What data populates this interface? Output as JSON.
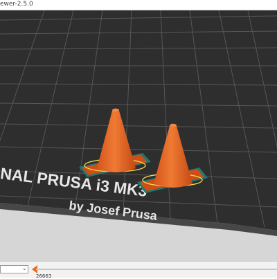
{
  "window": {
    "title": "ewer-2.5.0"
  },
  "viewer": {
    "bed_label_line1": "NAL PRUSA i3  MK3",
    "bed_label_line2": "by Josef Prusa",
    "objects": [
      "traffic-cone",
      "traffic-cone"
    ]
  },
  "bottom": {
    "layer_select_value": "",
    "slider_value": "26663",
    "slider_progress": 0
  },
  "colors": {
    "bed": "#2e2e2e",
    "grid": "#565656",
    "cone": "#ed6b21",
    "accent": "#ed6b21",
    "skirt": "#f2d54a",
    "pad_outline": "#1f8f86"
  }
}
